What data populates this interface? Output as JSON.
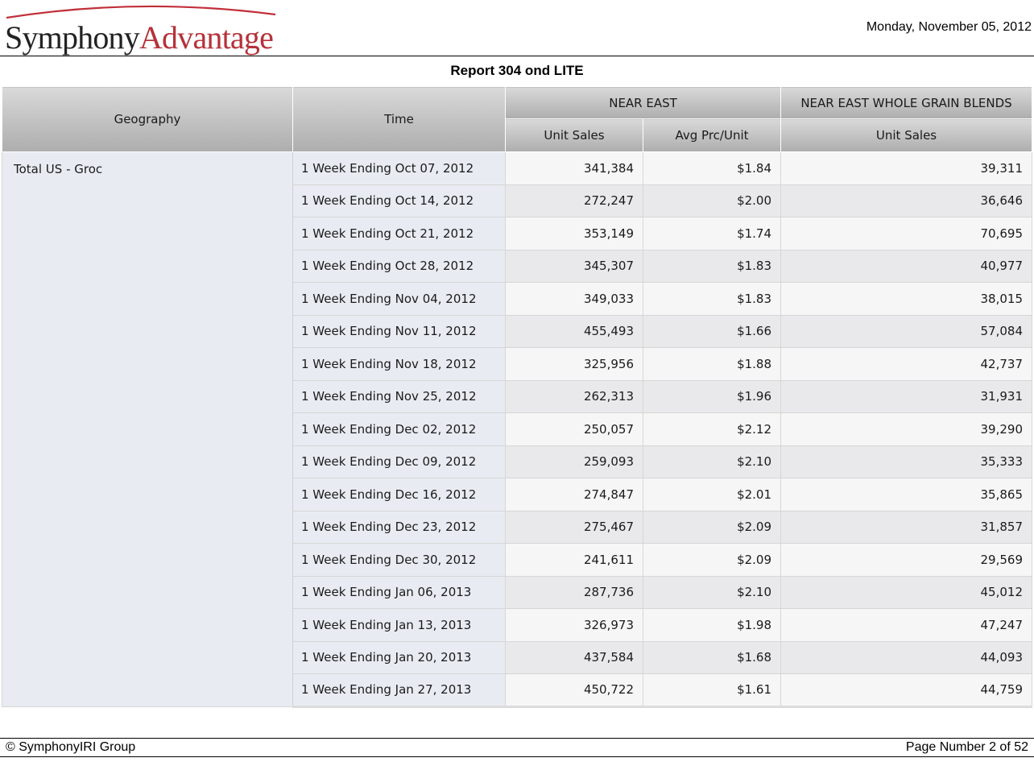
{
  "header": {
    "logo_part1": "Symphony",
    "logo_part2": "Advantage",
    "date": "Monday, November 05, 2012"
  },
  "report": {
    "title": "Report 304 ond LITE"
  },
  "table": {
    "col_geography": "Geography",
    "col_time": "Time",
    "group_near_east": "NEAR EAST",
    "group_whole_grain": "NEAR EAST WHOLE GRAIN BLENDS",
    "sub_unit_sales": "Unit Sales",
    "sub_avg_price": "Avg Prc/Unit",
    "sub_unit_sales_2": "Unit Sales",
    "geography": "Total US - Groc",
    "rows": [
      {
        "time": "1 Week Ending Oct 07, 2012",
        "unit_sales": "341,384",
        "avg_price": "$1.84",
        "wg_unit_sales": "39,311"
      },
      {
        "time": "1 Week Ending Oct 14, 2012",
        "unit_sales": "272,247",
        "avg_price": "$2.00",
        "wg_unit_sales": "36,646"
      },
      {
        "time": "1 Week Ending Oct 21, 2012",
        "unit_sales": "353,149",
        "avg_price": "$1.74",
        "wg_unit_sales": "70,695"
      },
      {
        "time": "1 Week Ending Oct 28, 2012",
        "unit_sales": "345,307",
        "avg_price": "$1.83",
        "wg_unit_sales": "40,977"
      },
      {
        "time": "1 Week Ending Nov 04, 2012",
        "unit_sales": "349,033",
        "avg_price": "$1.83",
        "wg_unit_sales": "38,015"
      },
      {
        "time": "1 Week Ending Nov 11, 2012",
        "unit_sales": "455,493",
        "avg_price": "$1.66",
        "wg_unit_sales": "57,084"
      },
      {
        "time": "1 Week Ending Nov 18, 2012",
        "unit_sales": "325,956",
        "avg_price": "$1.88",
        "wg_unit_sales": "42,737"
      },
      {
        "time": "1 Week Ending Nov 25, 2012",
        "unit_sales": "262,313",
        "avg_price": "$1.96",
        "wg_unit_sales": "31,931"
      },
      {
        "time": "1 Week Ending Dec 02, 2012",
        "unit_sales": "250,057",
        "avg_price": "$2.12",
        "wg_unit_sales": "39,290"
      },
      {
        "time": "1 Week Ending Dec 09, 2012",
        "unit_sales": "259,093",
        "avg_price": "$2.10",
        "wg_unit_sales": "35,333"
      },
      {
        "time": "1 Week Ending Dec 16, 2012",
        "unit_sales": "274,847",
        "avg_price": "$2.01",
        "wg_unit_sales": "35,865"
      },
      {
        "time": "1 Week Ending Dec 23, 2012",
        "unit_sales": "275,467",
        "avg_price": "$2.09",
        "wg_unit_sales": "31,857"
      },
      {
        "time": "1 Week Ending Dec 30, 2012",
        "unit_sales": "241,611",
        "avg_price": "$2.09",
        "wg_unit_sales": "29,569"
      },
      {
        "time": "1 Week Ending Jan 06, 2013",
        "unit_sales": "287,736",
        "avg_price": "$2.10",
        "wg_unit_sales": "45,012"
      },
      {
        "time": "1 Week Ending Jan 13, 2013",
        "unit_sales": "326,973",
        "avg_price": "$1.98",
        "wg_unit_sales": "47,247"
      },
      {
        "time": "1 Week Ending Jan 20, 2013",
        "unit_sales": "437,584",
        "avg_price": "$1.68",
        "wg_unit_sales": "44,093"
      },
      {
        "time": "1 Week Ending Jan 27, 2013",
        "unit_sales": "450,722",
        "avg_price": "$1.61",
        "wg_unit_sales": "44,759"
      }
    ]
  },
  "footer": {
    "copyright": "© SymphonyIRI Group",
    "page_number": "Page Number 2 of 52"
  }
}
